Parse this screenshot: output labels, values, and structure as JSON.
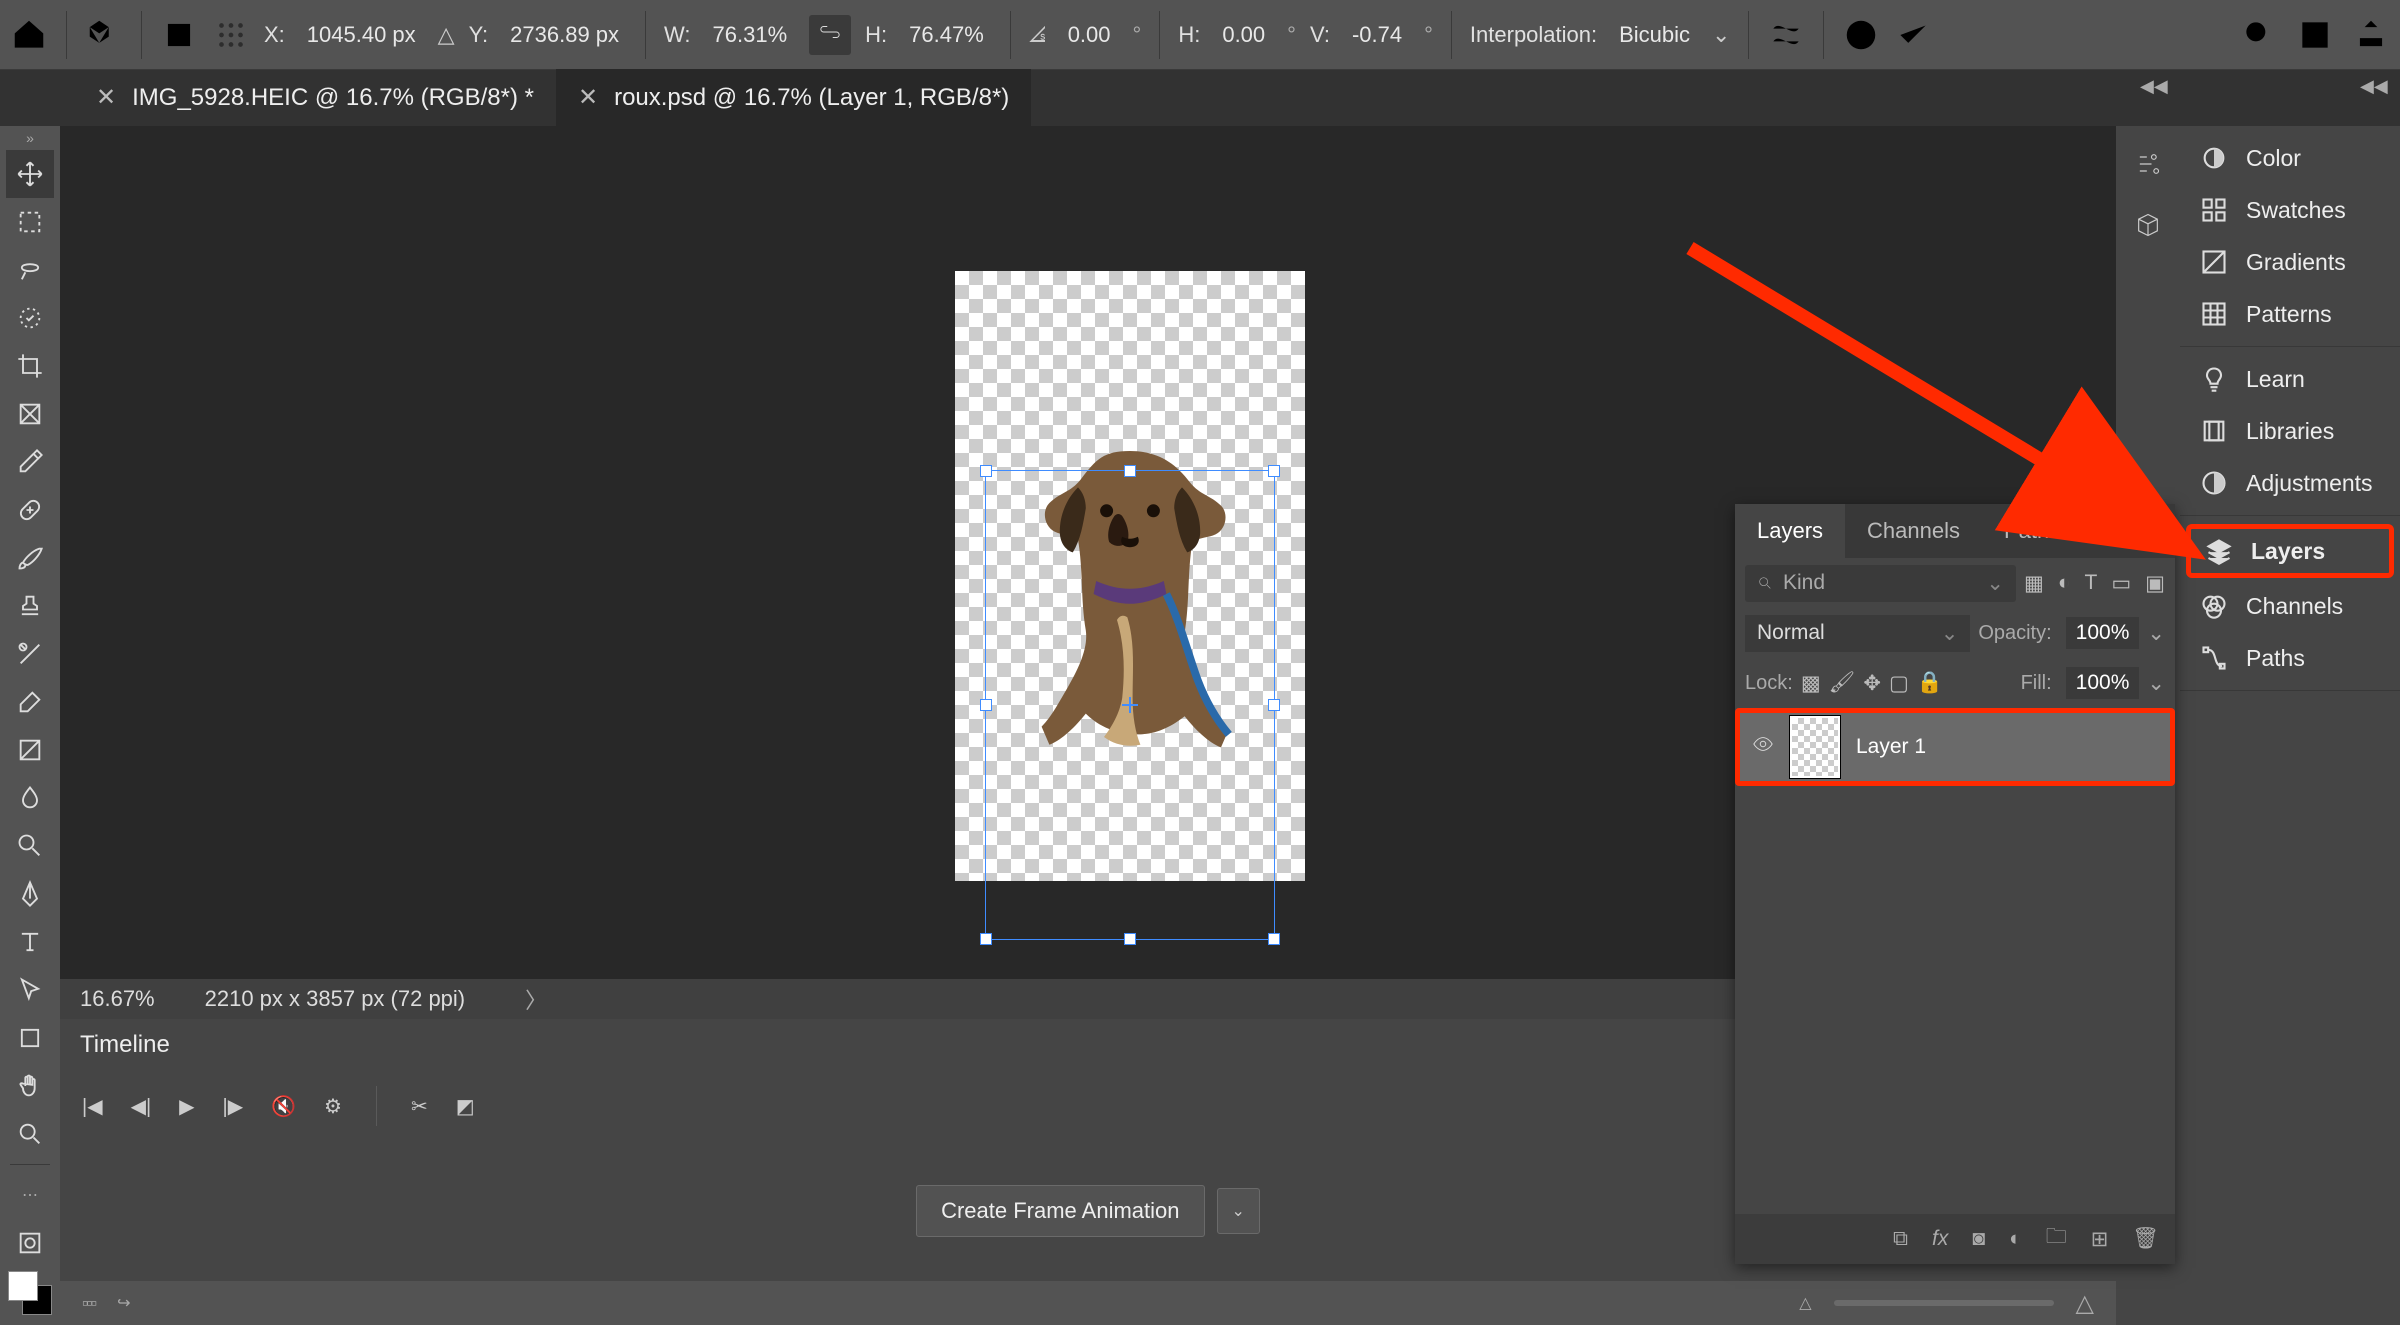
{
  "options_bar": {
    "x_label": "X:",
    "x_value": "1045.40 px",
    "y_label": "Y:",
    "y_value": "2736.89 px",
    "w_label": "W:",
    "w_value": "76.31%",
    "h_label": "H:",
    "h_value": "76.47%",
    "angle_value": "0.00",
    "skew_h_label": "H:",
    "skew_h_value": "0.00",
    "skew_v_label": "V:",
    "skew_v_value": "-0.74",
    "interp_label": "Interpolation:",
    "interp_value": "Bicubic"
  },
  "tabs": {
    "t1": "IMG_5928.HEIC @ 16.7% (RGB/8*) *",
    "t2": "roux.psd @ 16.7% (Layer 1, RGB/8*)"
  },
  "status": {
    "zoom": "16.67%",
    "dims": "2210 px x 3857 px (72 ppi)"
  },
  "timeline": {
    "title": "Timeline",
    "cfa": "Create Frame Animation"
  },
  "layers_panel": {
    "tab_layers": "Layers",
    "tab_channels": "Channels",
    "tab_paths": "Paths",
    "kind": "Kind",
    "blend": "Normal",
    "opacity_label": "Opacity:",
    "opacity_value": "100%",
    "lock_label": "Lock:",
    "fill_label": "Fill:",
    "fill_value": "100%",
    "layer1": "Layer 1"
  },
  "right_panel": {
    "color": "Color",
    "swatches": "Swatches",
    "gradients": "Gradients",
    "patterns": "Patterns",
    "learn": "Learn",
    "libraries": "Libraries",
    "adjustments": "Adjustments",
    "layers": "Layers",
    "channels": "Channels",
    "paths": "Paths"
  },
  "search_placeholder": "Kind"
}
